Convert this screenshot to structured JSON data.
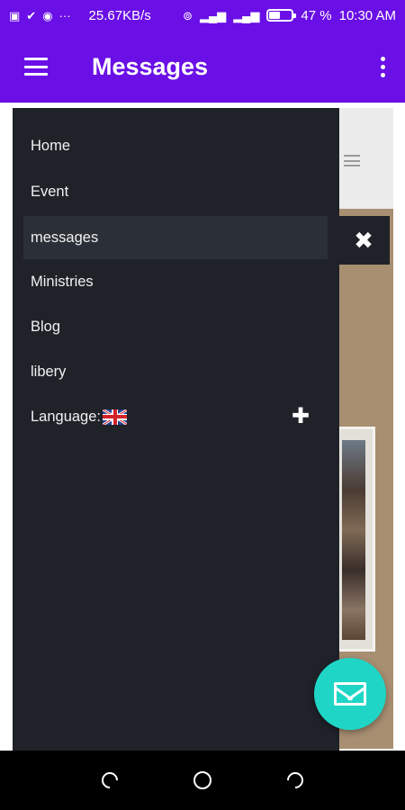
{
  "status_bar": {
    "speed": "25.67KB/s",
    "battery_percent": "47 %",
    "battery_level": 0.47,
    "time": "10:30 AM",
    "icons": [
      "screenshot-icon",
      "check-icon",
      "record-icon",
      "more-icon",
      "hotspot-icon",
      "signal-icon",
      "signal-icon",
      "battery-icon"
    ]
  },
  "app_bar": {
    "title": "Messages",
    "menu_icon": "hamburger-icon",
    "overflow_icon": "more-vert-icon"
  },
  "drawer": {
    "items": [
      {
        "label": "Home"
      },
      {
        "label": "Event"
      },
      {
        "label": "messages",
        "active": true
      },
      {
        "label": "Ministries"
      },
      {
        "label": "Blog"
      },
      {
        "label": "libery"
      },
      {
        "label": "Language:",
        "flag": "uk-flag-icon",
        "expand_icon": "plus-icon"
      }
    ],
    "close_icon": "close-icon"
  },
  "fab": {
    "icon": "mail-icon"
  },
  "nav_bar": {
    "icons": [
      "back-icon",
      "home-icon",
      "recents-icon"
    ]
  },
  "colors": {
    "primary": "#6a0fe6",
    "drawer": "#1f2229",
    "drawer_active": "#2b2f37",
    "fab": "#1fd6c6"
  }
}
